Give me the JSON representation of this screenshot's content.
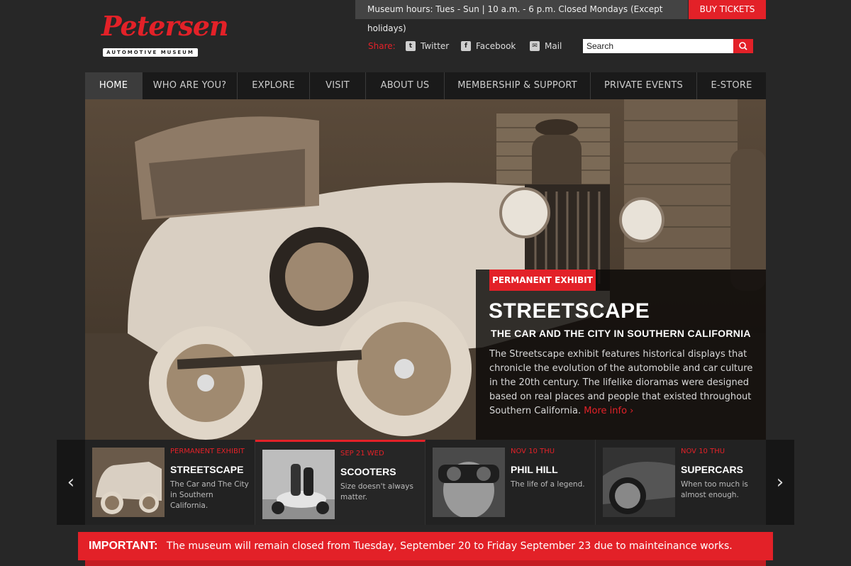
{
  "brand": {
    "name": "Petersen",
    "subtitle": "AUTOMOTIVE MUSEUM"
  },
  "topbar": {
    "hours": "Museum hours: Tues - Sun | 10 a.m. - 6 p.m. Closed Mondays (Except holidays)",
    "buy_label": "BUY TICKETS"
  },
  "share": {
    "label": "Share:",
    "items": [
      {
        "label": "Twitter",
        "icon": "twitter-icon"
      },
      {
        "label": "Facebook",
        "icon": "facebook-icon"
      },
      {
        "label": "Mail",
        "icon": "mail-icon"
      }
    ]
  },
  "search": {
    "value": "Search"
  },
  "nav": [
    {
      "label": "HOME",
      "active": true
    },
    {
      "label": "WHO ARE YOU?"
    },
    {
      "label": "EXPLORE"
    },
    {
      "label": "VISIT"
    },
    {
      "label": "ABOUT US"
    },
    {
      "label": "MEMBERSHIP & SUPPORT"
    },
    {
      "label": "PRIVATE EVENTS"
    },
    {
      "label": "E-STORE"
    }
  ],
  "hero": {
    "tag": "PERMANENT EXHIBIT",
    "title": "STREETSCAPE",
    "subtitle": "THE CAR AND THE CITY IN SOUTHERN CALIFORNIA",
    "body": "The Streetscape exhibit features historical displays that chronicle the evolution of the automobile and car culture in the 20th century. The lifelike dioramas were designed based on real places and people that existed throughout Southern California.",
    "more": "More info ›"
  },
  "carousel": {
    "prev": "‹",
    "next": "›",
    "cards": [
      {
        "date": "PERMANENT EXHIBIT",
        "title": "STREETSCAPE",
        "desc": "The Car and The City in Southern California."
      },
      {
        "date": "SEP 21 WED",
        "title": "SCOOTERS",
        "desc": "Size doesn't always matter."
      },
      {
        "date": "NOV 10 THU",
        "title": "PHIL HILL",
        "desc": "The life of a legend."
      },
      {
        "date": "NOV 10 THU",
        "title": "SUPERCARS",
        "desc": "When too much is almost enough."
      }
    ]
  },
  "notice": {
    "label": "IMPORTANT:",
    "text": "The museum will remain closed from Tuesday, September 20 to Friday September 23 due to mainteinance works."
  },
  "colors": {
    "accent": "#e32128",
    "background": "#272727"
  }
}
